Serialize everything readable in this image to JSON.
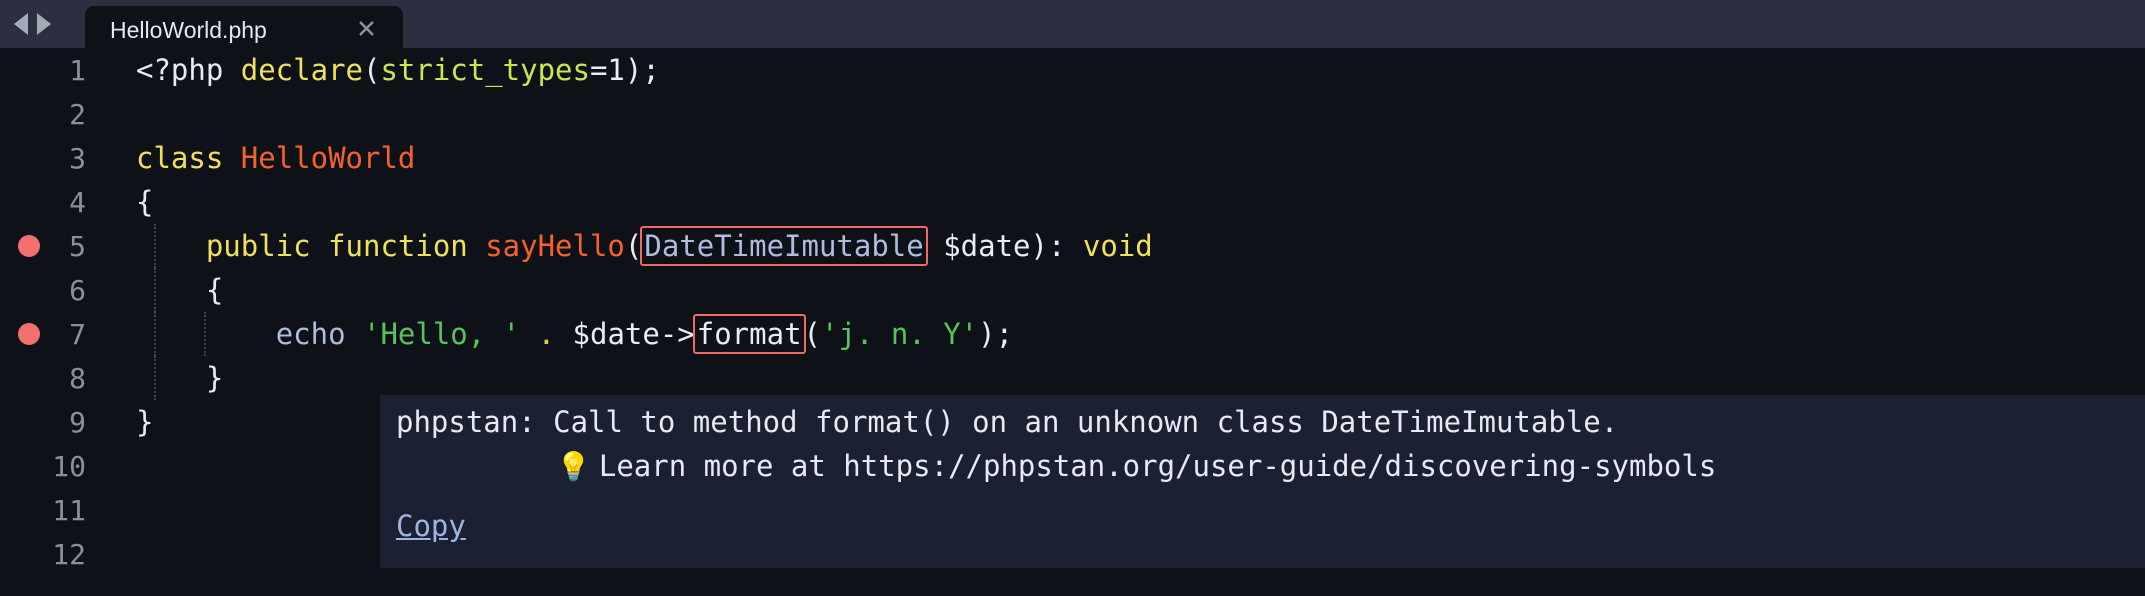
{
  "tabbar": {
    "nav_back_icon": "arrow-left-icon",
    "nav_forward_icon": "arrow-right-icon",
    "active_tab": "HelloWorld.php",
    "close_glyph": "✕"
  },
  "editor": {
    "background": "#0f1119",
    "gutter_color": "#8a8f9e",
    "breakpoint_color": "#f2706e",
    "lines": [
      {
        "n": "1",
        "breakpoint": false
      },
      {
        "n": "2",
        "breakpoint": false
      },
      {
        "n": "3",
        "breakpoint": false
      },
      {
        "n": "4",
        "breakpoint": false
      },
      {
        "n": "5",
        "breakpoint": true
      },
      {
        "n": "6",
        "breakpoint": false
      },
      {
        "n": "7",
        "breakpoint": true
      },
      {
        "n": "8",
        "breakpoint": false
      },
      {
        "n": "9",
        "breakpoint": false
      },
      {
        "n": "10",
        "breakpoint": false
      },
      {
        "n": "11",
        "breakpoint": false
      },
      {
        "n": "12",
        "breakpoint": false
      }
    ],
    "code": {
      "l1_open": "<?php ",
      "l1_declare": "declare",
      "l1_paren": "(",
      "l1_strict": "strict_types",
      "l1_tail": "=1);",
      "l3_class": "class",
      "l3_space": " ",
      "l3_name": "HelloWorld",
      "l4_brace": "{",
      "l5_indent": "    ",
      "l5_public": "public function",
      "l5_space": " ",
      "l5_method": "sayHello",
      "l5_lparen": "(",
      "l5_type": "DateTimeImutable",
      "l5_arg": " $date): ",
      "l5_void": "void",
      "l6_brace": "    {",
      "l7_indent": "        ",
      "l7_echo": "echo",
      "l7_sp": " ",
      "l7_str1": "'Hello, '",
      "l7_sp2": " ",
      "l7_dot": ".",
      "l7_var": " $date->",
      "l7_format": "format",
      "l7_lparen": "(",
      "l7_str2": "'j. n. Y'",
      "l7_tail": ");",
      "l8_brace": "    }",
      "l9_brace": "}"
    },
    "error_border_color": "#ef6a62"
  },
  "tooltip": {
    "background": "#1b2032",
    "message": "phpstan: Call to method format() on an unknown class DateTimeImutable.",
    "bulb_icon": "💡",
    "hint": "Learn more at https://phpstan.org/user-guide/discovering-symbols",
    "copy_label": "Copy"
  }
}
